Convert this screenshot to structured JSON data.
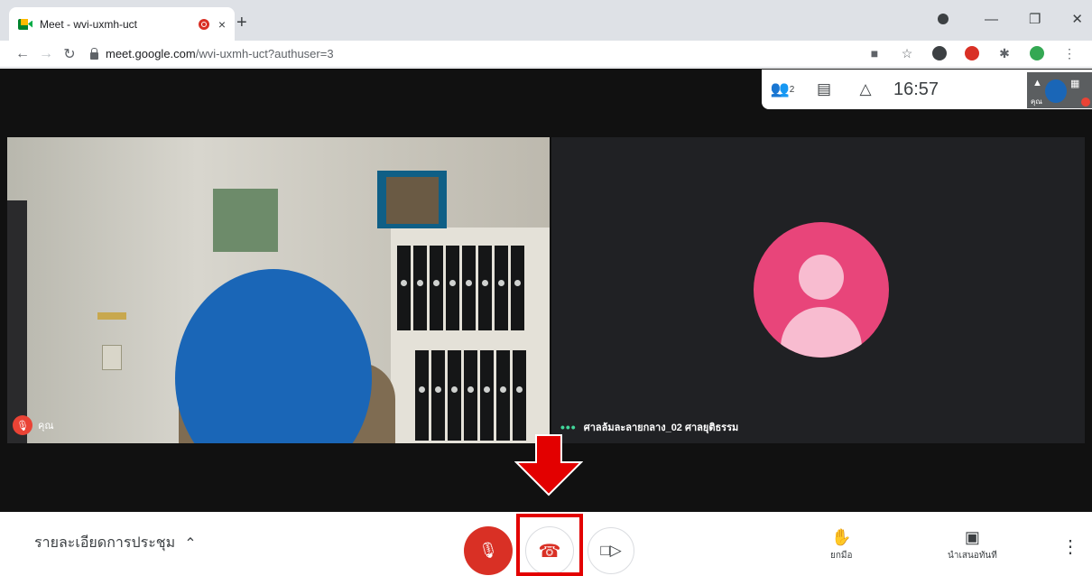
{
  "browser": {
    "tab_title": "Meet - wvi-uxmh-uct",
    "tab_close": "×",
    "new_tab": "+",
    "url_host": "meet.google.com",
    "url_path": "/wvi-uxmh-uct?authuser=3"
  },
  "meet": {
    "participant_count": "2",
    "clock": "16:57",
    "self_thumb_label": "คุณ",
    "left_tile_name": "คุณ",
    "right_tile_name": "ศาลล้มละลายกลาง_02 ศาลยุติธรรม",
    "meeting_details": "รายละเอียดการประชุม",
    "raise_hand_label": "ยกมือ",
    "present_label": "นำเสนอทันที"
  },
  "colors": {
    "mic_off_red": "#d93025",
    "highlight_red": "#e30000",
    "avatar_pink": "#e8457a",
    "face_blur_blue": "#1a66b7"
  },
  "icons": [
    "meet-favicon",
    "recording-icon",
    "back-icon",
    "forward-icon",
    "reload-icon",
    "lock-icon",
    "camera-blocked-icon",
    "star-icon",
    "people-icon",
    "chat-icon",
    "activities-icon",
    "mic-off-icon",
    "end-call-icon",
    "camera-icon",
    "raise-hand-icon",
    "present-icon",
    "more-icon"
  ]
}
